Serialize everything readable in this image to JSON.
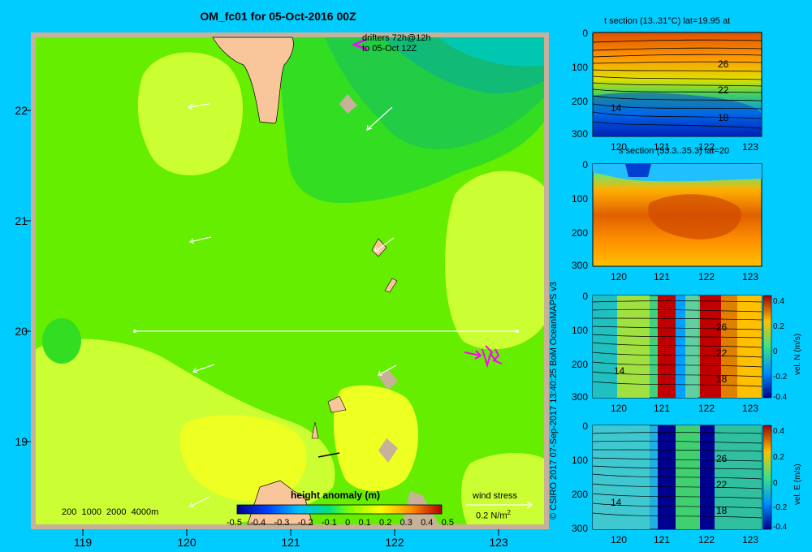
{
  "title": "OM_fc01 for 05-Oct-2016 00Z",
  "main_map": {
    "y_ticks": [
      "22",
      "21",
      "20",
      "19"
    ],
    "x_ticks": [
      "119",
      "120",
      "121",
      "122",
      "123"
    ],
    "drifters_label_1": "drifters 72h@12h",
    "drifters_label_2": "to 05-Oct 12Z",
    "depth_legend": "200  1000  2000  4000m",
    "colorbar_title": "height anomaly  (m)",
    "colorbar_ticks": [
      "-0.5",
      "-0.4",
      "-0.3",
      "-0.2",
      "-0.1",
      "0",
      "0.1",
      "0.2",
      "0.3",
      "0.4",
      "0.5"
    ],
    "wind_stress_label": "wind stress",
    "wind_stress_value": "0.2 N/m",
    "wind_stress_exp": "2",
    "colors": {
      "background": "#00ccff",
      "land": "#f9c69b",
      "shelf": "#c7b299",
      "drifter": "#ff00ff"
    }
  },
  "credit": "© CSIRO 2017   07-Sep-2017 13:40:25 BoM OceanMAPS v3",
  "sections": [
    {
      "title": "t section (13..31°C) lat=19.95 at",
      "y_ticks": [
        "0",
        "100",
        "200",
        "300"
      ],
      "x_ticks": [
        "120",
        "121",
        "122",
        "123"
      ],
      "contour_labels": [
        "26",
        "22",
        "18",
        "14"
      ]
    },
    {
      "title": "s section (33.3..35.3) lat=20",
      "y_ticks": [
        "0",
        "100",
        "200",
        "300"
      ],
      "x_ticks": [
        "120",
        "121",
        "122",
        "123"
      ],
      "contour_labels": []
    },
    {
      "title": "",
      "y_ticks": [
        "0",
        "100",
        "200",
        "300"
      ],
      "x_ticks": [
        "120",
        "121",
        "122",
        "123"
      ],
      "contour_labels": [
        "26",
        "22",
        "18",
        "14"
      ],
      "colorbar_label": "vel. N (m/s)",
      "colorbar_ticks": [
        "0.4",
        "0.2",
        "0",
        "-0.2",
        "-0.4"
      ]
    },
    {
      "title": "",
      "y_ticks": [
        "0",
        "100",
        "200",
        "300"
      ],
      "x_ticks": [
        "120",
        "121",
        "122",
        "123"
      ],
      "contour_labels": [
        "26",
        "22",
        "18",
        "14"
      ],
      "colorbar_label": "vel. E (m/s)",
      "colorbar_ticks": [
        "0.4",
        "0.2",
        "0",
        "-0.2",
        "-0.4"
      ]
    }
  ],
  "chart_data": [
    {
      "type": "heatmap",
      "title": "OM_fc01 for 05-Oct-2016 00Z",
      "variable": "height anomaly (m)",
      "xlim": [
        118.5,
        123.5
      ],
      "ylim": [
        18.3,
        22.7
      ],
      "xticks": [
        119,
        120,
        121,
        122,
        123
      ],
      "yticks": [
        19,
        20,
        21,
        22
      ],
      "colorbar_range": [
        -0.5,
        0.5
      ],
      "section_line": {
        "lat": 20,
        "lon_from": 119.5,
        "lon_to": 123.2
      }
    },
    {
      "type": "heatmap",
      "title": "t section (13..31°C) lat=19.95 at",
      "variable": "temperature (°C)",
      "range": [
        13,
        31
      ],
      "xlim": [
        119.5,
        123.2
      ],
      "ylim": [
        300,
        0
      ],
      "contour_values": [
        26,
        22,
        18,
        14
      ]
    },
    {
      "type": "heatmap",
      "title": "s section (33.3..35.3) lat=20",
      "variable": "salinity",
      "range": [
        33.3,
        35.3
      ],
      "xlim": [
        119.5,
        123.2
      ],
      "ylim": [
        300,
        0
      ]
    },
    {
      "type": "heatmap",
      "variable": "vel. N (m/s)",
      "range": [
        -0.4,
        0.4
      ],
      "xlim": [
        119.5,
        123.2
      ],
      "ylim": [
        300,
        0
      ],
      "contour_values": [
        26,
        22,
        18,
        14
      ]
    },
    {
      "type": "heatmap",
      "variable": "vel. E (m/s)",
      "range": [
        -0.4,
        0.4
      ],
      "xlim": [
        119.5,
        123.2
      ],
      "ylim": [
        300,
        0
      ],
      "contour_values": [
        26,
        22,
        18,
        14
      ]
    }
  ]
}
